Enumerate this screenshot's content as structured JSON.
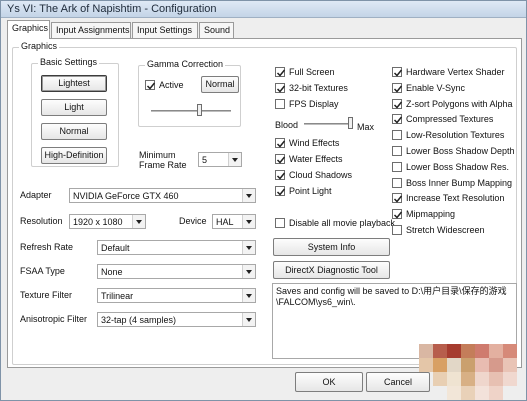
{
  "window": {
    "title": "Ys VI: The Ark of Napishtim - Configuration"
  },
  "tabs": [
    {
      "label": "Graphics"
    },
    {
      "label": "Input Assignments"
    },
    {
      "label": "Input Settings"
    },
    {
      "label": "Sound"
    }
  ],
  "graphics": {
    "group_label": "Graphics",
    "basic_settings": {
      "label": "Basic Settings",
      "buttons": [
        "Lightest",
        "Light",
        "Normal",
        "High-Definition"
      ],
      "selected": "Lightest"
    },
    "gamma": {
      "label": "Gamma Correction",
      "active_label": "Active",
      "active_checked": true,
      "normal_button": "Normal",
      "slider_position": 0.6
    },
    "min_frame_rate": {
      "label_line1": "Minimum",
      "label_line2": "Frame Rate",
      "value": "5"
    },
    "adapter": {
      "label": "Adapter",
      "value": "NVIDIA GeForce GTX 460"
    },
    "resolution": {
      "label": "Resolution",
      "value": "1920 x 1080"
    },
    "device": {
      "label": "Device",
      "value": "HAL"
    },
    "refresh_rate": {
      "label": "Refresh Rate",
      "value": "Default"
    },
    "fsaa_type": {
      "label": "FSAA Type",
      "value": "None"
    },
    "texture_filter": {
      "label": "Texture Filter",
      "value": "Trilinear"
    },
    "anisotropic_filter": {
      "label": "Anisotropic Filter",
      "value": "32-tap (4 samples)"
    },
    "middle_checks_top": [
      {
        "label": "Full Screen",
        "checked": true
      },
      {
        "label": "32-bit Textures",
        "checked": true
      },
      {
        "label": "FPS Display",
        "checked": false
      }
    ],
    "blood": {
      "label": "Blood",
      "max_label": "Max",
      "slider_position": 1.0
    },
    "middle_checks_bottom": [
      {
        "label": "Wind Effects",
        "checked": true
      },
      {
        "label": "Water Effects",
        "checked": true
      },
      {
        "label": "Cloud Shadows",
        "checked": true
      },
      {
        "label": "Point Light",
        "checked": true
      }
    ],
    "disable_movie": {
      "label": "Disable all movie playback",
      "checked": false
    },
    "system_info_button": "System Info",
    "directx_tool_button": "DirectX Diagnostic Tool",
    "save_info_line1": "Saves and config will be saved to D:\\用户目录\\保存的游戏",
    "save_info_line2": "\\FALCOM\\ys6_win\\.",
    "right_checks": [
      {
        "label": "Hardware Vertex Shader",
        "checked": true
      },
      {
        "label": "Enable V-Sync",
        "checked": true
      },
      {
        "label": "Z-sort Polygons with Alpha",
        "checked": true
      },
      {
        "label": "Compressed Textures",
        "checked": true
      },
      {
        "label": "Low-Resolution Textures",
        "checked": false
      },
      {
        "label": "Lower Boss Shadow Depth",
        "checked": false
      },
      {
        "label": "Lower Boss Shadow Res.",
        "checked": false
      },
      {
        "label": "Boss Inner Bump Mapping",
        "checked": false
      },
      {
        "label": "Increase Text Resolution",
        "checked": true
      },
      {
        "label": "Mipmapping",
        "checked": true
      },
      {
        "label": "Stretch Widescreen",
        "checked": false
      }
    ]
  },
  "footer": {
    "ok": "OK",
    "cancel": "Cancel"
  },
  "colors": {
    "title_bar": "#c3d4e7",
    "panel": "#ffffff",
    "dialog": "#eeeeee"
  }
}
